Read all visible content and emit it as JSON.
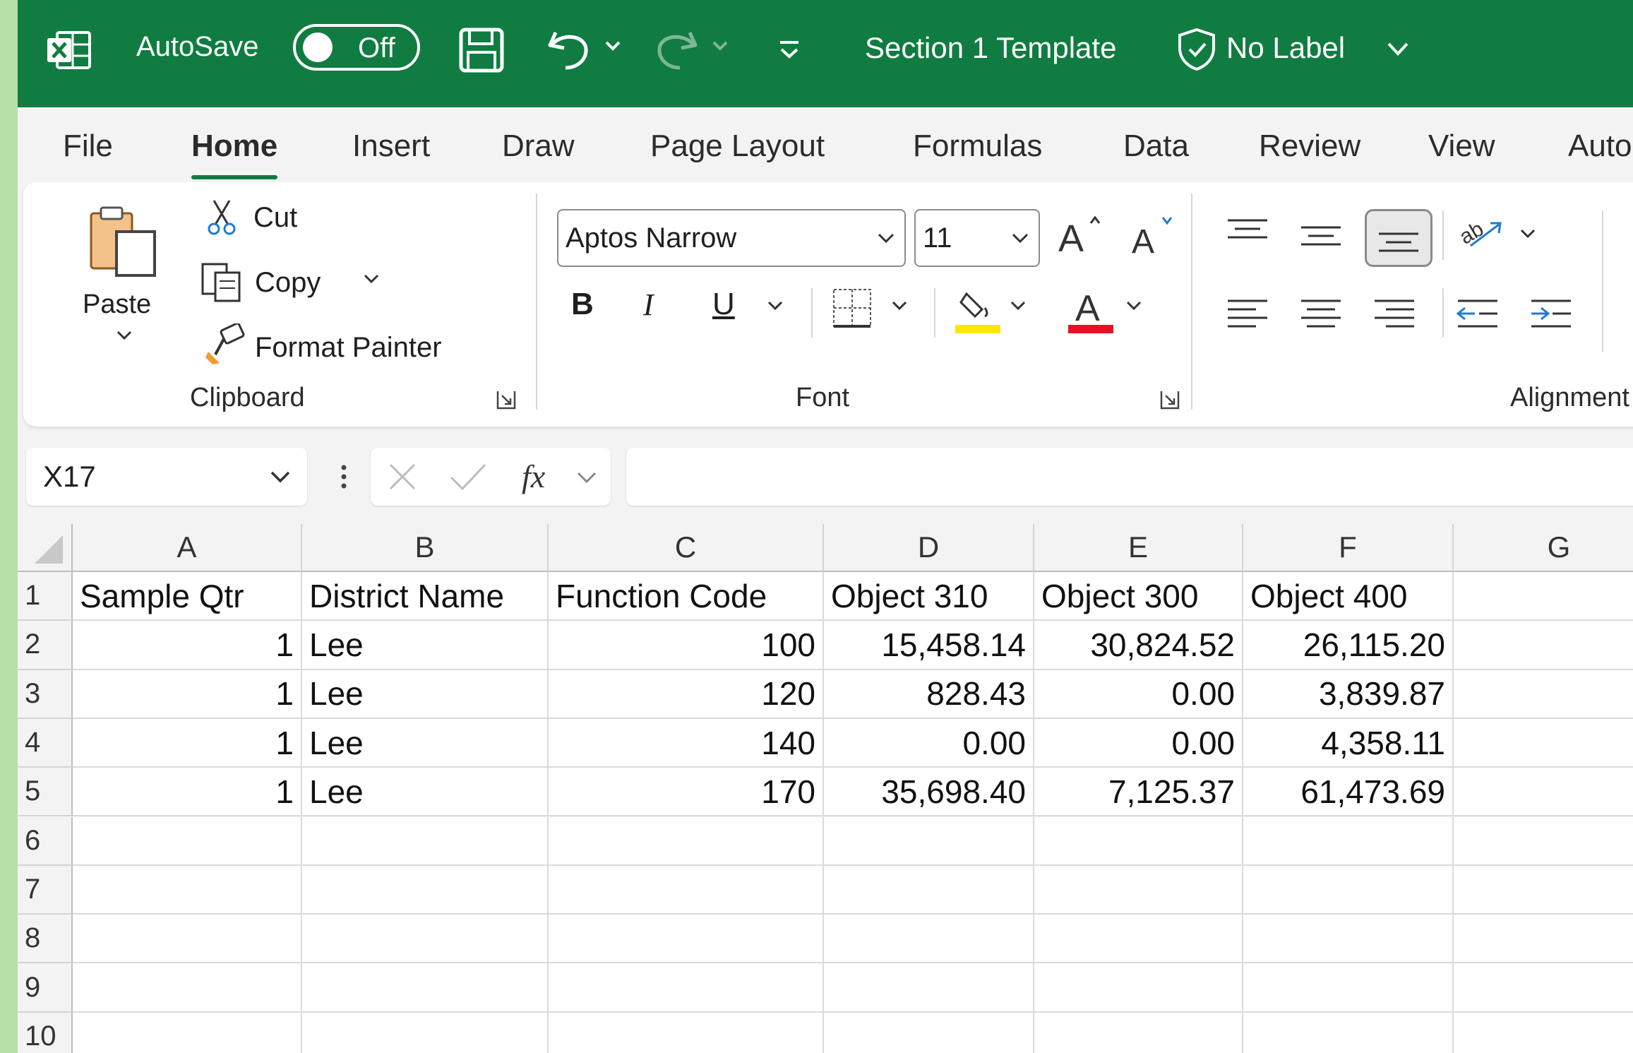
{
  "titlebar": {
    "autosave_label": "AutoSave",
    "autosave_state": "Off",
    "doc_title": "Section 1 Template",
    "sensitivity_label": "No Label"
  },
  "tabs": [
    "File",
    "Home",
    "Insert",
    "Draw",
    "Page Layout",
    "Formulas",
    "Data",
    "Review",
    "View",
    "Automate"
  ],
  "active_tab": "Home",
  "clipboard": {
    "paste": "Paste",
    "cut": "Cut",
    "copy": "Copy",
    "format_painter": "Format Painter",
    "group_label": "Clipboard"
  },
  "font": {
    "name": "Aptos Narrow",
    "size": "11",
    "bold": "B",
    "italic": "I",
    "underline": "U",
    "group_label": "Font",
    "fill_color": "#ffe600",
    "font_color": "#e81123"
  },
  "alignment": {
    "group_label": "Alignment"
  },
  "formula_bar": {
    "name_box": "X17",
    "fx": "fx",
    "formula": ""
  },
  "colors": {
    "accent": "#107c41"
  },
  "sheet": {
    "columns": [
      "A",
      "B",
      "C",
      "D",
      "E",
      "F",
      "G"
    ],
    "rows": [
      [
        "Sample Qtr",
        "District Name",
        "Function Code",
        "Object 310",
        "Object 300",
        "Object 400",
        ""
      ],
      [
        "1",
        "Lee",
        "100",
        "15,458.14",
        "30,824.52",
        "26,115.20",
        ""
      ],
      [
        "1",
        "Lee",
        "120",
        "828.43",
        "0.00",
        "3,839.87",
        ""
      ],
      [
        "1",
        "Lee",
        "140",
        "0.00",
        "0.00",
        "4,358.11",
        ""
      ],
      [
        "1",
        "Lee",
        "170",
        "35,698.40",
        "7,125.37",
        "61,473.69",
        ""
      ],
      [
        "",
        "",
        "",
        "",
        "",
        "",
        ""
      ],
      [
        "",
        "",
        "",
        "",
        "",
        "",
        ""
      ],
      [
        "",
        "",
        "",
        "",
        "",
        "",
        ""
      ],
      [
        "",
        "",
        "",
        "",
        "",
        "",
        ""
      ],
      [
        "",
        "",
        "",
        "",
        "",
        "",
        ""
      ]
    ],
    "row_numbers": [
      "1",
      "2",
      "3",
      "4",
      "5",
      "6",
      "7",
      "8",
      "9",
      "10"
    ]
  }
}
